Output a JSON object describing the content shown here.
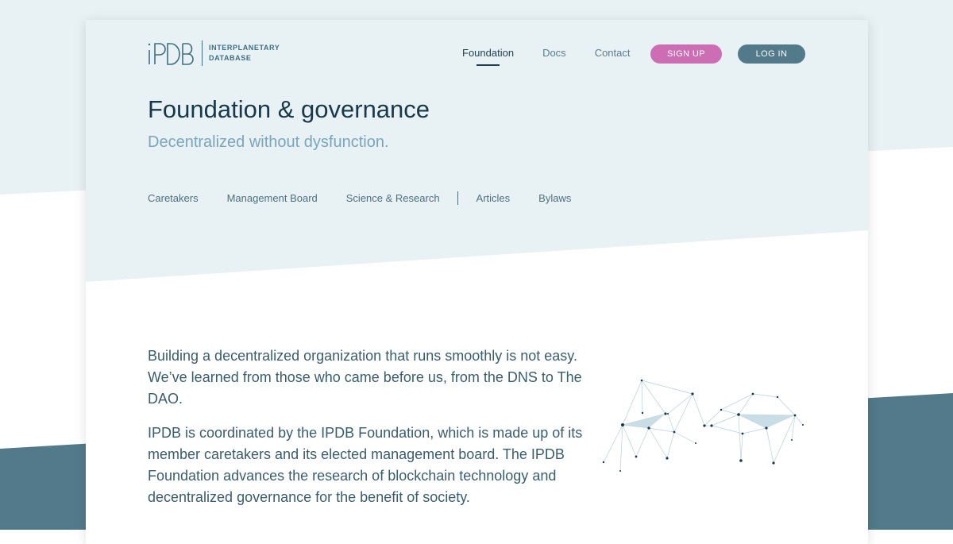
{
  "brand": {
    "logo_mark": "iPDB",
    "name_line1": "INTERPLANETARY",
    "name_line2": "DATABASE"
  },
  "nav": {
    "items": [
      {
        "label": "Foundation",
        "active": true
      },
      {
        "label": "Docs",
        "active": false
      },
      {
        "label": "Contact",
        "active": false
      }
    ],
    "signup_label": "SIGN UP",
    "login_label": "LOG IN"
  },
  "hero": {
    "title": "Foundation & governance",
    "subtitle": "Decentralized without dysfunction."
  },
  "subnav": {
    "items": [
      "Caretakers",
      "Management Board",
      "Science & Research",
      "Articles",
      "Bylaws"
    ]
  },
  "content": {
    "paragraphs": [
      "Building a decentralized organization that runs smoothly is not easy. We’ve learned from those who came before us, from the DNS to The DAO.",
      "IPDB is coordinated by the IPDB Foundation, which is made up of its member caretakers and its elected management board. The IPDB Foundation advances the research of blockchain technology and decentralized governance for the benefit of society."
    ]
  },
  "colors": {
    "accent_pink": "#cd6eb4",
    "accent_teal": "#527a8a",
    "hero_bg": "#e8f1f4",
    "dark_text": "#17394a",
    "network_icon": "network-graph-illustration"
  }
}
